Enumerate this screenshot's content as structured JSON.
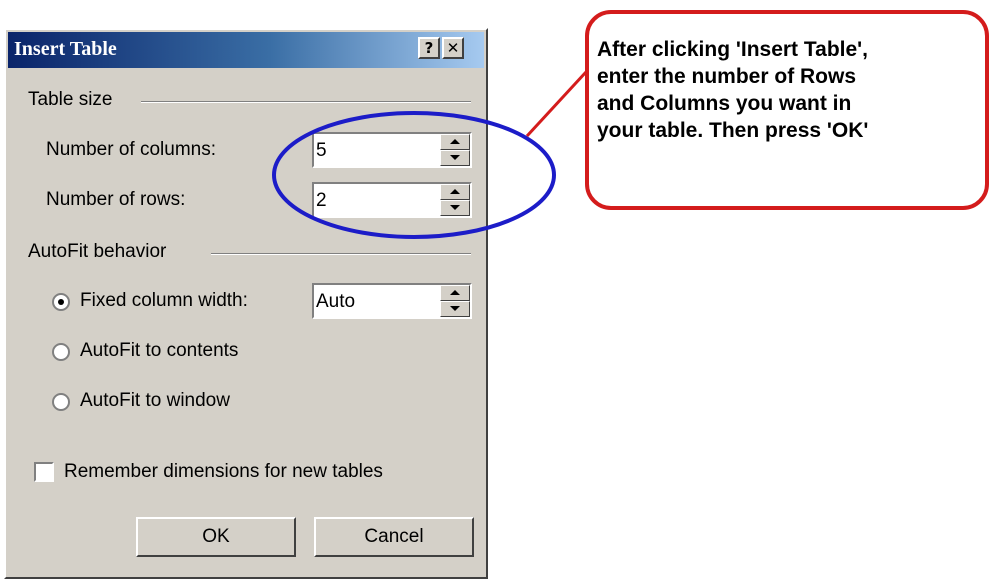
{
  "dialog": {
    "title": "Insert Table",
    "help_button": "?",
    "close_button": "✕",
    "table_size": {
      "group_label": "Table size",
      "columns_label": "Number of columns:",
      "columns_value": "5",
      "rows_label": "Number of rows:",
      "rows_value": "2"
    },
    "autofit": {
      "group_label": "AutoFit behavior",
      "fixed_label": "Fixed column width:",
      "fixed_value": "Auto",
      "contents_label": "AutoFit to contents",
      "window_label": "AutoFit to window",
      "selected": "fixed"
    },
    "remember_label": "Remember dimensions for new tables",
    "remember_checked": false,
    "ok_label": "OK",
    "cancel_label": "Cancel"
  },
  "callout": {
    "lines": [
      "After clicking 'Insert Table',",
      "enter the number of Rows",
      "and Columns you want in",
      "your table. Then press 'OK'"
    ],
    "border_color": "#d41c1c"
  },
  "annotation": {
    "ellipse_color": "#1c1cc8",
    "connector_color": "#d41c1c"
  },
  "colors": {
    "dialog_face": "#d4d0c8",
    "title_gradient_start": "#0a246a",
    "title_gradient_end": "#a6caf0"
  }
}
